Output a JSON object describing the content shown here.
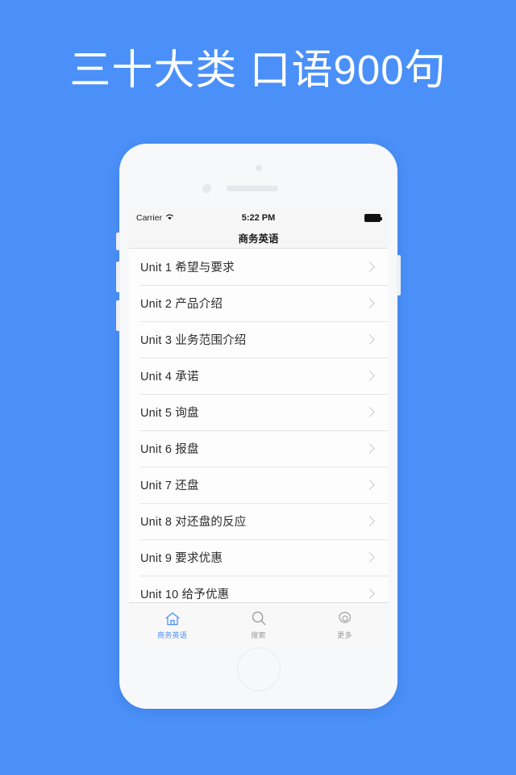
{
  "headline": "三十大类 口语900句",
  "theme": {
    "background": "#4a90f8",
    "accent": "#4a90f8",
    "phone_body": "#f7f8fa",
    "screen": "#fdfdfd"
  },
  "phone": {
    "status_bar": {
      "carrier": "Carrier",
      "wifi_icon": "wifi-icon",
      "time": "5:22 PM",
      "battery_icon": "battery-full-icon"
    },
    "nav_bar": {
      "title": "商务英语"
    },
    "list": {
      "rows": [
        {
          "label": "Unit 1 希望与要求",
          "accessory": "chevron-right-icon"
        },
        {
          "label": "Unit 2 产品介绍",
          "accessory": "chevron-right-icon"
        },
        {
          "label": "Unit 3 业务范围介绍",
          "accessory": "chevron-right-icon"
        },
        {
          "label": "Unit 4 承诺",
          "accessory": "chevron-right-icon"
        },
        {
          "label": "Unit 5 询盘",
          "accessory": "chevron-right-icon"
        },
        {
          "label": "Unit 6 报盘",
          "accessory": "chevron-right-icon"
        },
        {
          "label": "Unit 7 还盘",
          "accessory": "chevron-right-icon"
        },
        {
          "label": "Unit 8 对还盘的反应",
          "accessory": "chevron-right-icon"
        },
        {
          "label": "Unit 9 要求优惠",
          "accessory": "chevron-right-icon"
        },
        {
          "label": "Unit 10 给予优惠",
          "accessory": "chevron-right-icon"
        }
      ]
    },
    "tab_bar": {
      "tabs": [
        {
          "label": "商务英语",
          "icon": "home-icon",
          "active": true
        },
        {
          "label": "搜索",
          "icon": "search-icon",
          "active": false
        },
        {
          "label": "更多",
          "icon": "gear-icon",
          "active": false
        }
      ]
    }
  }
}
